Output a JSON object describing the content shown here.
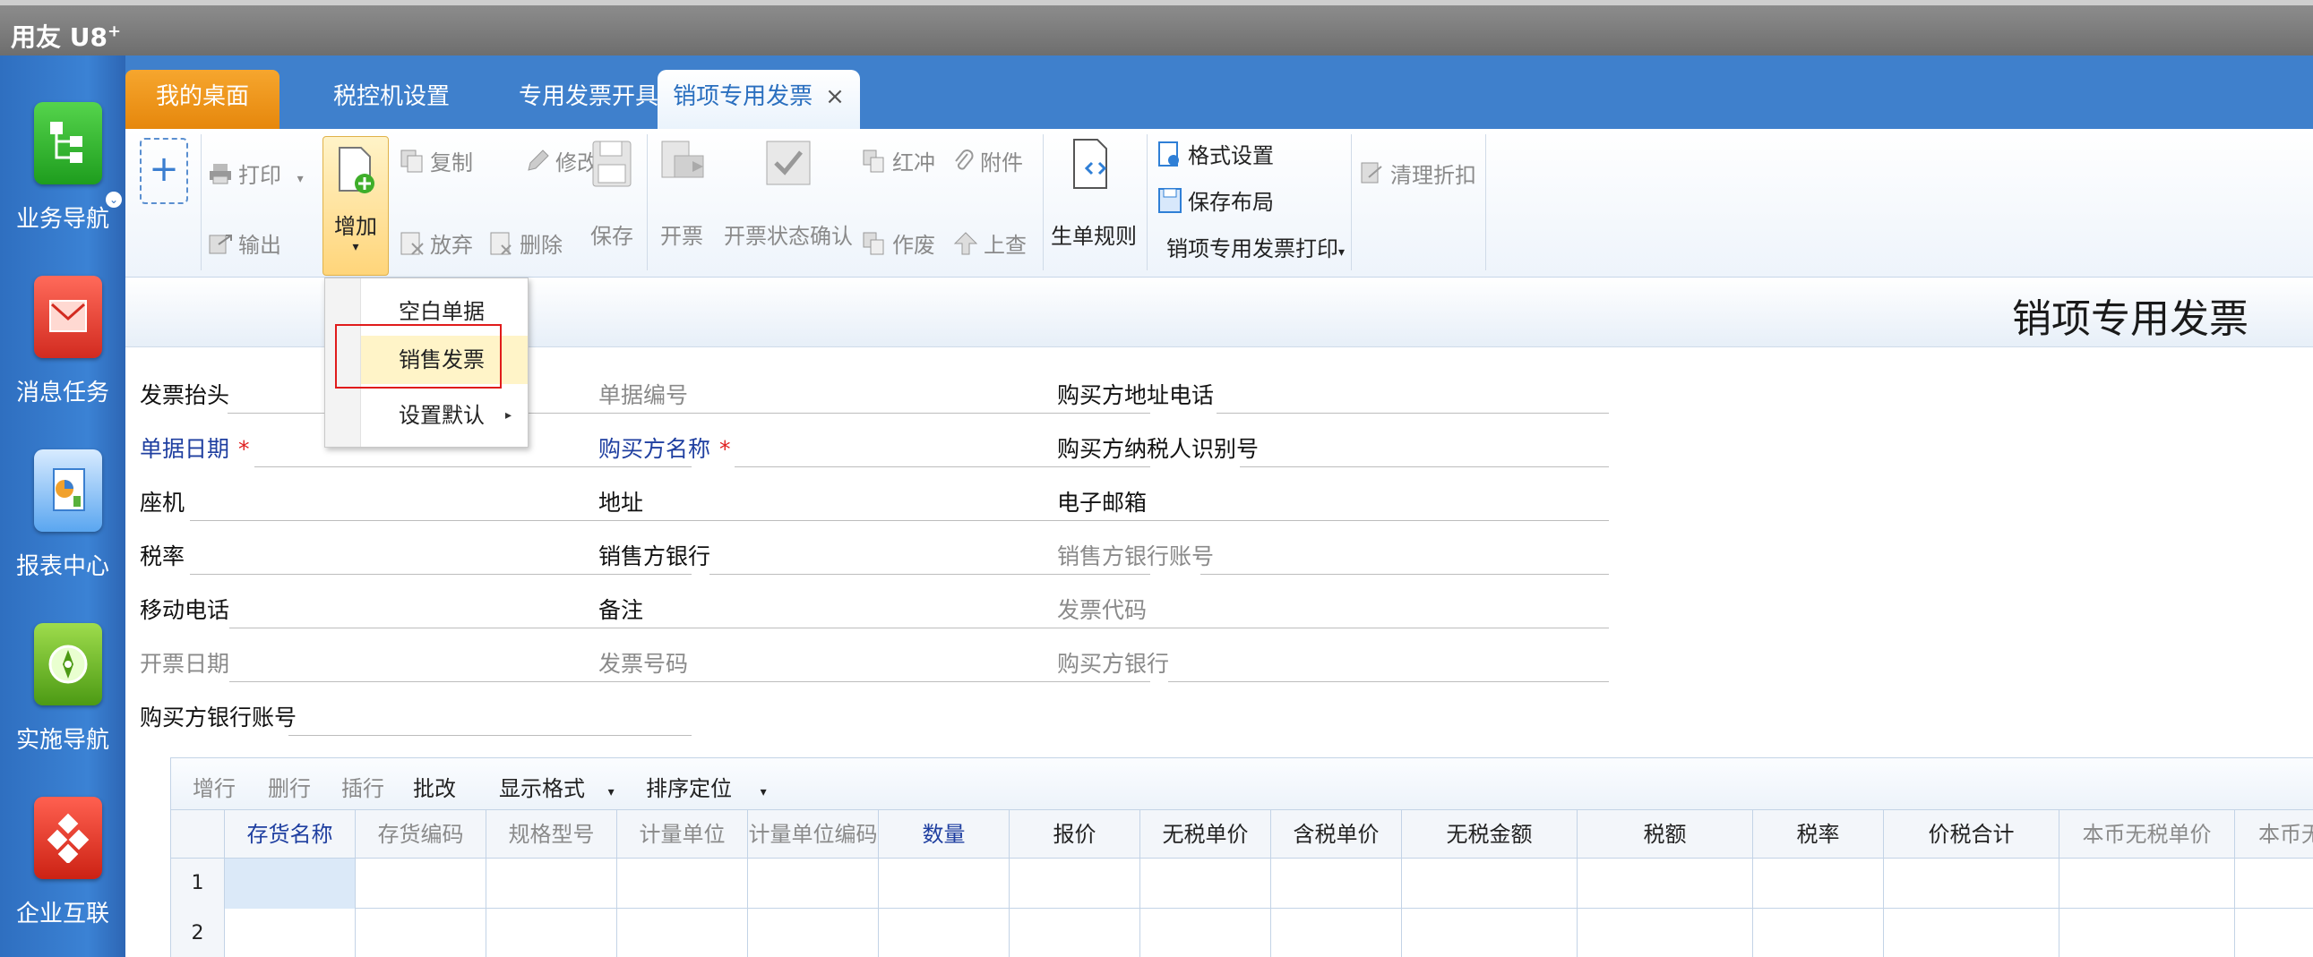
{
  "app": {
    "brand": "用友 U8",
    "brand_sup": "+"
  },
  "left_nav": [
    {
      "label": "业务导航",
      "icon": "business-nav-icon"
    },
    {
      "label": "消息任务",
      "icon": "message-task-icon"
    },
    {
      "label": "报表中心",
      "icon": "report-center-icon"
    },
    {
      "label": "实施导航",
      "icon": "implementation-nav-icon"
    },
    {
      "label": "企业互联",
      "icon": "enterprise-connect-icon"
    }
  ],
  "tabs": [
    {
      "label": "我的桌面"
    },
    {
      "label": "税控机设置"
    },
    {
      "label": "专用发票开具"
    },
    {
      "label": "销项专用发票",
      "close": "×"
    }
  ],
  "toolbar": {
    "print": "打印",
    "export": "输出",
    "add": "增加",
    "copy": "复制",
    "modify": "修改",
    "discard": "放弃",
    "delete": "删除",
    "save": "保存",
    "issue": "开票",
    "issue_confirm": "开票状态确认",
    "red_offset": "红冲",
    "void": "作废",
    "attachment": "附件",
    "lookup": "上查",
    "gen_rule": "生单规则",
    "format_settings": "格式设置",
    "save_layout": "保存布局",
    "print_menu": "销项专用发票打印",
    "clear_discount": "清理折扣"
  },
  "add_menu": {
    "items": [
      "空白单据",
      "销售发票",
      "设置默认"
    ]
  },
  "form": {
    "title": "销项专用发票",
    "col1": [
      "发票抬头",
      "单据日期",
      "座机",
      "税率",
      "移动电话",
      "开票日期",
      "购买方银行账号"
    ],
    "col2": [
      "单据编号",
      "购买方名称",
      "地址",
      "销售方银行",
      "备注",
      "发票号码"
    ],
    "col3": [
      "购买方地址电话",
      "购买方纳税人识别号",
      "电子邮箱",
      "销售方银行账号",
      "发票代码",
      "购买方银行"
    ],
    "required_mark": "*"
  },
  "grid": {
    "tools": [
      "增行",
      "删行",
      "插行",
      "批改",
      "显示格式",
      "排序定位"
    ],
    "columns": [
      "存货名称",
      "存货编码",
      "规格型号",
      "计量单位",
      "计量单位编码",
      "数量",
      "报价",
      "无税单价",
      "含税单价",
      "无税金额",
      "税额",
      "税率",
      "价税合计",
      "本币无税单价",
      "本币无"
    ],
    "rows": [
      "1",
      "2"
    ]
  }
}
